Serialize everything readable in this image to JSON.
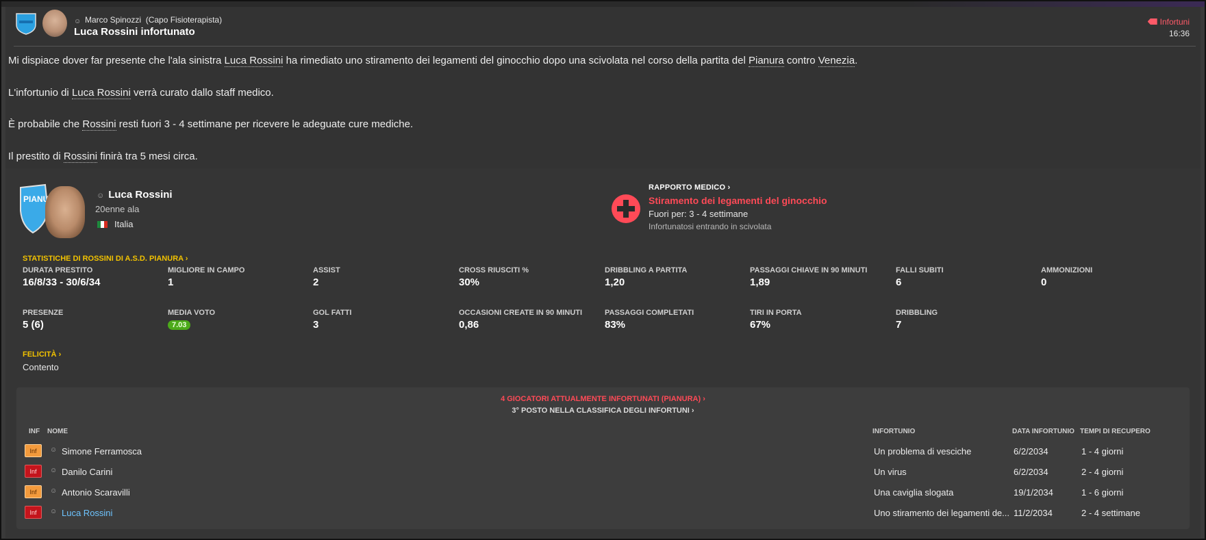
{
  "message": {
    "sender": "Marco Spinozzi",
    "sender_role": "(Capo Fisioterapista)",
    "subject": "Luca Rossini infortunato",
    "category": "Infortuni",
    "time": "16:36",
    "paragraphs": [
      [
        "Mi dispiace dover far presente che l'ala sinistra ",
        "Luca Rossini",
        " ha rimediato uno stiramento dei legamenti del ginocchio dopo una scivolata nel corso della partita del ",
        "Pianura",
        " contro ",
        "Venezia",
        "."
      ],
      [
        "L'infortunio di ",
        "Luca Rossini",
        " verrà curato dallo staff medico."
      ],
      [
        "È probabile che ",
        "Rossini",
        " resti fuori 3 - 4 settimane per ricevere le adeguate cure mediche."
      ],
      [
        "Il prestito di ",
        "Rossini",
        " finirà tra 5 mesi circa."
      ]
    ]
  },
  "player": {
    "name": "Luca Rossini",
    "role": "20enne ala",
    "nation": "Italia",
    "club_badge_text": "PIANU"
  },
  "medical": {
    "title": "RAPPORTO MEDICO",
    "injury": "Stiramento dei legamenti del ginocchio",
    "out_for": "Fuori per: 3 - 4 settimane",
    "how": "Infortunatosi entrando in scivolata"
  },
  "stats": {
    "heading": "STATISTICHE DI ROSSINI DI A.S.D. PIANURA",
    "row1": [
      {
        "label": "DURATA PRESTITO",
        "value": "16/8/33 - 30/6/34"
      },
      {
        "label": "MIGLIORE IN CAMPO",
        "value": "1"
      },
      {
        "label": "ASSIST",
        "value": "2"
      },
      {
        "label": "CROSS RIUSCITI %",
        "value": "30%"
      },
      {
        "label": "DRIBBLING A PARTITA",
        "value": "1,20"
      },
      {
        "label": "PASSAGGI CHIAVE IN 90 MINUTI",
        "value": "1,89"
      },
      {
        "label": "FALLI SUBITI",
        "value": "6"
      },
      {
        "label": "AMMONIZIONI",
        "value": "0"
      }
    ],
    "row2": [
      {
        "label": "PRESENZE",
        "value": "5 (6)"
      },
      {
        "label": "MEDIA VOTO",
        "value": "7.03"
      },
      {
        "label": "GOL FATTI",
        "value": "3"
      },
      {
        "label": "OCCASIONI CREATE IN 90 MINUTI",
        "value": "0,86"
      },
      {
        "label": "PASSAGGI COMPLETATI",
        "value": "83%"
      },
      {
        "label": "TIRI IN PORTA",
        "value": "67%"
      },
      {
        "label": "DRIBBLING",
        "value": "7"
      }
    ]
  },
  "happiness": {
    "heading": "FELICITÀ",
    "value": "Contento"
  },
  "injuries": {
    "heading": "4 GIOCATORI ATTUALMENTE INFORTUNATI (PIANURA)",
    "subheading": "3° POSTO NELLA CLASSIFICA DEGLI INFORTUNI",
    "columns": {
      "inf": "INF",
      "name": "NOME",
      "injury": "INFORTUNIO",
      "date": "DATA INFORTUNIO",
      "recovery": "TEMPI DI RECUPERO"
    },
    "rows": [
      {
        "badge": "Inf",
        "severity": "minor",
        "name": "Simone Ferramosca",
        "injury": "Un problema di vesciche",
        "date": "6/2/2034",
        "recovery": "1 - 4 giorni"
      },
      {
        "badge": "Inf",
        "severity": "serious",
        "name": "Danilo Carini",
        "injury": "Un virus",
        "date": "6/2/2034",
        "recovery": "2 - 4 giorni"
      },
      {
        "badge": "Inf",
        "severity": "minor",
        "name": "Antonio Scaravilli",
        "injury": "Una caviglia slogata",
        "date": "19/1/2034",
        "recovery": "1 - 6 giorni"
      },
      {
        "badge": "Inf",
        "severity": "serious",
        "name": "Luca Rossini",
        "injury": "Uno stiramento dei legamenti de...",
        "date": "11/2/2034",
        "recovery": "2 - 4 settimane"
      }
    ]
  },
  "colors": {
    "accent_red": "#ff4a57",
    "accent_yellow": "#f2c200",
    "link_blue": "#6ec4ff",
    "rating_green": "#4caa1a"
  }
}
